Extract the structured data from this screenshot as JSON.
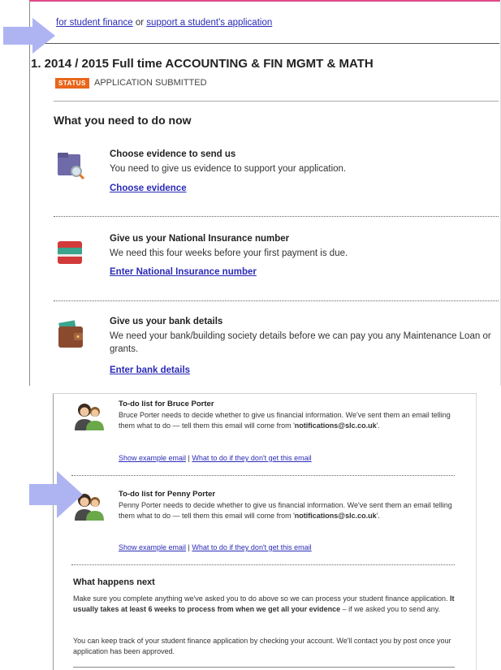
{
  "header": {
    "apply_tail": "for student finance",
    "or_text": " or ",
    "support_link": "support a student's application"
  },
  "application": {
    "title": "1. 2014 / 2015 Full time ACCOUNTING & FIN MGMT & MATH",
    "status_badge": "STATUS",
    "status_text": "APPLICATION SUBMITTED"
  },
  "todo_section": {
    "heading": "What you need to do now",
    "tasks": [
      {
        "title": "Choose evidence to send us",
        "description": "You need to give us evidence to support your application.",
        "link": "Choose evidence",
        "icon": "folder-search-icon"
      },
      {
        "title": "Give us your National Insurance number",
        "description": "We need this four weeks before your first payment is due.",
        "link": "Enter National Insurance number",
        "icon": "id-card-icon"
      },
      {
        "title": "Give us your bank details",
        "description": "We need your bank/building society details before we can pay you any Maintenance Loan or grants.",
        "link": "Enter bank details",
        "icon": "wallet-icon"
      }
    ]
  },
  "sponsors": [
    {
      "title": "To-do list for Bruce Porter",
      "description_pre": "Bruce Porter needs to decide whether to give us financial information. We've sent them an email telling them what to do — tell them this email will come from '",
      "email": "notifications@slc.co.uk",
      "description_post": "'.",
      "link_example": "Show example email",
      "separator": " | ",
      "link_help": "What to do if they don't get this email",
      "icon": "people-icon"
    },
    {
      "title": "To-do list for Penny Porter",
      "description_pre": "Penny Porter needs to decide whether to give us financial information. We've sent them an email telling them what to do — tell them this email will come from '",
      "email": "notifications@slc.co.uk",
      "description_post": "'.",
      "link_example": "Show example email",
      "separator": " | ",
      "link_help": "What to do if they don't get this email",
      "icon": "people-icon"
    }
  ],
  "what_next": {
    "heading": "What happens next",
    "p1_pre": "Make sure you complete anything we've asked you to do above so we can process your student finance application. ",
    "p1_bold": "It usually takes at least 6 weeks to process from when we get all your evidence",
    "p1_post": " – if we asked you to send any.",
    "p2": "You can keep track of your student finance application by checking your account. We'll contact you by post once your application has been approved."
  },
  "colors": {
    "accent_pink": "#e04b8a",
    "status_orange": "#e8661b",
    "link_blue": "#2b2bb8",
    "arrow_lavender": "#aeb4f2"
  }
}
